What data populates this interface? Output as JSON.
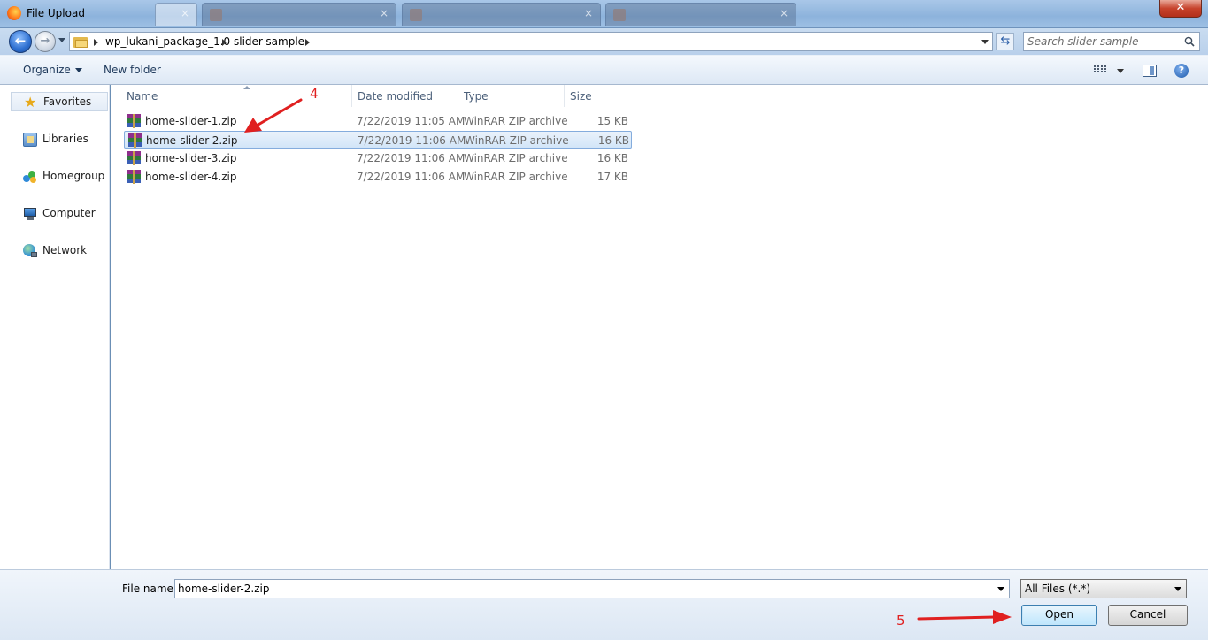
{
  "window": {
    "title": "File Upload",
    "close_label": "✕"
  },
  "address_bar": {
    "crumbs": [
      "wp_lukani_package_1.0",
      "slider-sample"
    ],
    "search_placeholder": "Search slider-sample"
  },
  "toolbar": {
    "organize_label": "Organize",
    "new_folder_label": "New folder",
    "help_label": "?"
  },
  "nav_pane": {
    "items": [
      {
        "label": "Favorites",
        "icon": "star-icon"
      },
      {
        "label": "Libraries",
        "icon": "libraries-icon"
      },
      {
        "label": "Homegroup",
        "icon": "homegroup-icon"
      },
      {
        "label": "Computer",
        "icon": "computer-icon"
      },
      {
        "label": "Network",
        "icon": "network-icon"
      }
    ]
  },
  "file_list": {
    "columns": [
      "Name",
      "Date modified",
      "Type",
      "Size"
    ],
    "rows": [
      {
        "name": "home-slider-1.zip",
        "date": "7/22/2019 11:05 AM",
        "type": "WinRAR ZIP archive",
        "size": "15 KB",
        "selected": false
      },
      {
        "name": "home-slider-2.zip",
        "date": "7/22/2019 11:06 AM",
        "type": "WinRAR ZIP archive",
        "size": "16 KB",
        "selected": true
      },
      {
        "name": "home-slider-3.zip",
        "date": "7/22/2019 11:06 AM",
        "type": "WinRAR ZIP archive",
        "size": "16 KB",
        "selected": false
      },
      {
        "name": "home-slider-4.zip",
        "date": "7/22/2019 11:06 AM",
        "type": "WinRAR ZIP archive",
        "size": "17 KB",
        "selected": false
      }
    ]
  },
  "footer": {
    "file_name_label": "File name:",
    "file_name_value": "home-slider-2.zip",
    "file_type_value": "All Files (*.*)",
    "open_label": "Open",
    "cancel_label": "Cancel"
  },
  "annotations": {
    "step_4": "4",
    "step_5": "5",
    "color": "#e02020"
  }
}
